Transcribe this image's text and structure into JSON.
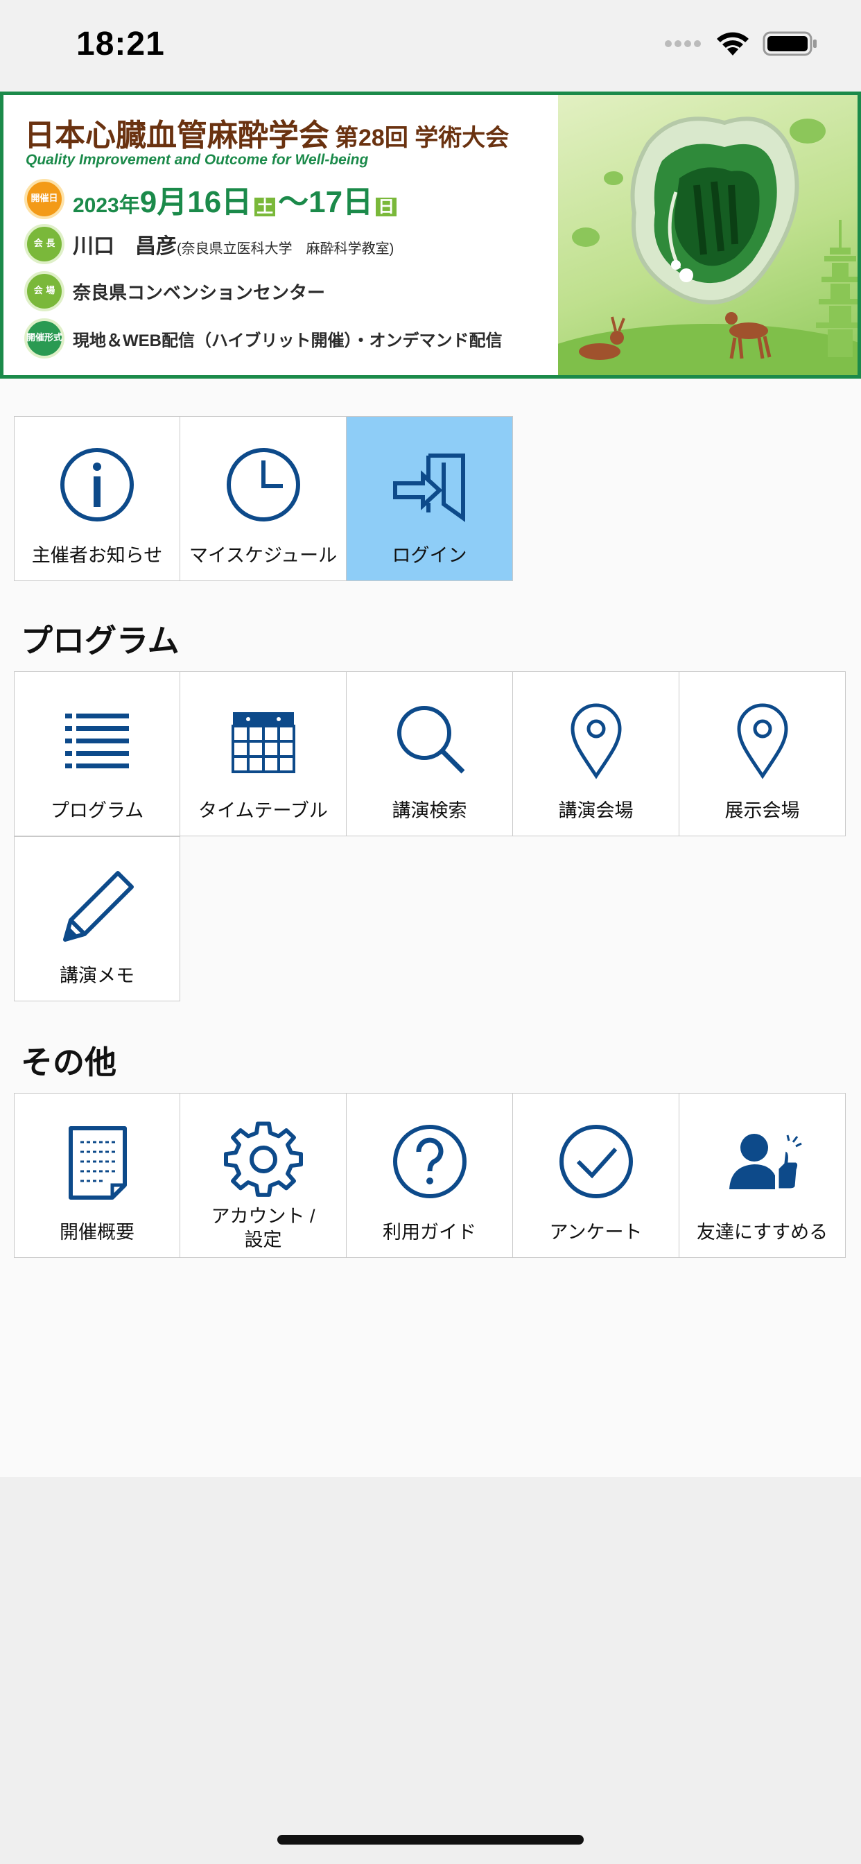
{
  "status_bar": {
    "time": "18:21"
  },
  "banner": {
    "title": "日本心臓血管麻酔学会",
    "title_suffix": "第28回 学術大会",
    "subtitle": "Quality Improvement and Outcome for Well-being",
    "date_badge": "開催日",
    "date_year": "2023年",
    "date_main": "9月16日",
    "date_sat": "土",
    "date_tilde": "～17日",
    "date_sun": "日",
    "president_badge": "会 長",
    "president_name": "川口　昌彦",
    "president_affil": "(奈良県立医科大学　麻酔科学教室)",
    "venue_badge": "会 場",
    "venue_name": "奈良県コンベンションセンター",
    "format_badge": "開催形式",
    "format_text": "現地＆WEB配信（ハイブリット開催）・オンデマンド配信"
  },
  "top_tiles": [
    {
      "label": "主催者お知らせ",
      "icon": "info-icon"
    },
    {
      "label": "マイスケジュール",
      "icon": "clock-icon"
    },
    {
      "label": "ログイン",
      "icon": "login-icon"
    }
  ],
  "program_section": {
    "title": "プログラム",
    "tiles": [
      {
        "label": "プログラム",
        "icon": "list-icon"
      },
      {
        "label": "タイムテーブル",
        "icon": "calendar-icon"
      },
      {
        "label": "講演検索",
        "icon": "search-icon"
      },
      {
        "label": "講演会場",
        "icon": "location-pin-icon"
      },
      {
        "label": "展示会場",
        "icon": "location-pin-icon"
      },
      {
        "label": "講演メモ",
        "icon": "pencil-icon"
      }
    ]
  },
  "other_section": {
    "title": "その他",
    "tiles": [
      {
        "label": "開催概要",
        "icon": "document-icon"
      },
      {
        "label_line1": "アカウント /",
        "label_line2": "設定",
        "icon": "gear-icon"
      },
      {
        "label": "利用ガイド",
        "icon": "help-icon"
      },
      {
        "label": "アンケート",
        "icon": "check-circle-icon"
      },
      {
        "label": "友達にすすめる",
        "icon": "recommend-icon"
      }
    ]
  },
  "colors": {
    "icon_blue": "#0d4a8a",
    "login_bg": "#8ecdf7",
    "banner_green": "#1b8a4a",
    "banner_brown": "#6a3210"
  }
}
